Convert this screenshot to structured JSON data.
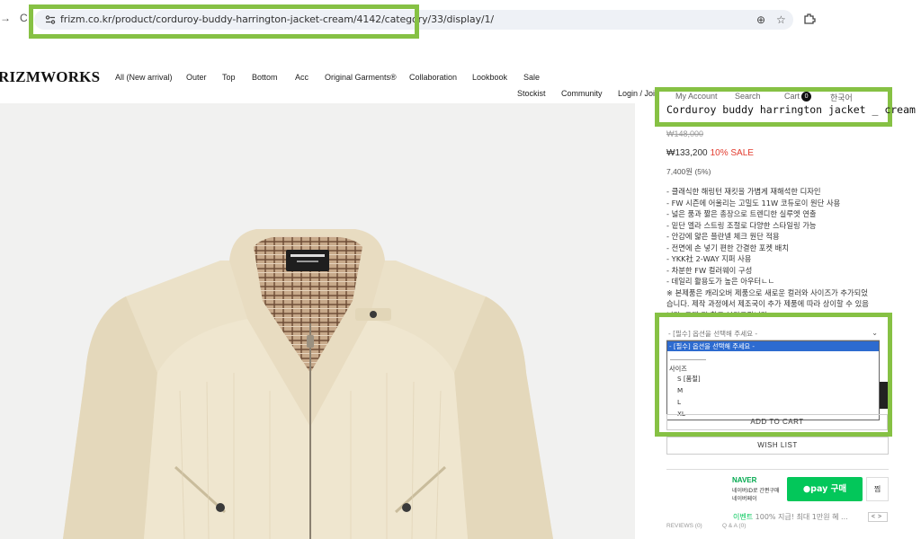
{
  "browser": {
    "url": "frizm.co.kr/product/corduroy-buddy-harrington-jacket-cream/4142/category/33/display/1/",
    "back_glyph": "→",
    "reload_glyph": "C",
    "zoom_glyph": "⊕",
    "star_glyph": "☆",
    "accent": "#86c144"
  },
  "header": {
    "logo": "RIZMWORKS",
    "nav": [
      "All (New arrival)",
      "Outer",
      "Top",
      "Bottom",
      "Acc",
      "Original Garments®",
      "Collaboration",
      "Lookbook",
      "Sale"
    ],
    "util": [
      "Stockist",
      "Community",
      "Login / Joi"
    ],
    "util_hidden": [
      "My Account",
      "Search",
      "Cart",
      "한국어"
    ],
    "cart_count": "0"
  },
  "product": {
    "title": "Corduroy buddy harrington jacket _ cream",
    "original_price": "₩148,000",
    "sale_price": "₩133,200",
    "sale_badge": "10% SALE",
    "points": "7,400원 (5%)",
    "description": [
      "- 클래식한 해링턴 재킷을 가볍게 재해석한 디자인",
      "- FW 시즌에 어울리는 고밀도 11W 코듀로이 원단 사용",
      "- 넓은 품과 짧은 총장으로 트렌디한 실루엣 연출",
      "- 밑단 엘라 스트링 조절로 다양한 스타일링 가능",
      "- 안감에 얇은 플란넬 체크 원단 적용",
      "- 전면에 손 넣기 편한 간결한 포켓 배치",
      "- YKK社 2-WAY 지퍼 사용",
      "- 차분한 FW 컬러웨이 구성",
      "- 데일리 활용도가 높은 아우터ㄴㄴ",
      "※ 본제품은 캐리오버 제품으로 새로운 컬러와 사이즈가 추가되었",
      "습니다. 제작 과정에서 제조국이 추가 제품에 따라 상이할 수 있음",
      "니다. 구매 전 참고 부탁드립니다."
    ]
  },
  "options": {
    "placeholder": "- [필수] 옵션을 선택해 주세요 -",
    "selected": "- [필수] 옵션을 선택해 주세요 -",
    "separator": "-------------------",
    "group_label": "사이즈",
    "sizes": [
      "S [품절]",
      "M",
      "L",
      "XL"
    ]
  },
  "buttons": {
    "add_to_cart": "ADD TO CART",
    "wish_list": "WISH LIST"
  },
  "naver": {
    "logo": "NAVER",
    "sub1": "네이버ID로 간편구매",
    "sub2": "네이버페이",
    "pay_label": "●pay 구매",
    "wish_label": "찜",
    "event_tag": "이벤트",
    "event_text": "100% 지급! 최대 1만원 혜 ...",
    "pager": "<>"
  },
  "tabs": {
    "reviews": "REVIEWS (0)",
    "qa": "Q & A (0)"
  }
}
